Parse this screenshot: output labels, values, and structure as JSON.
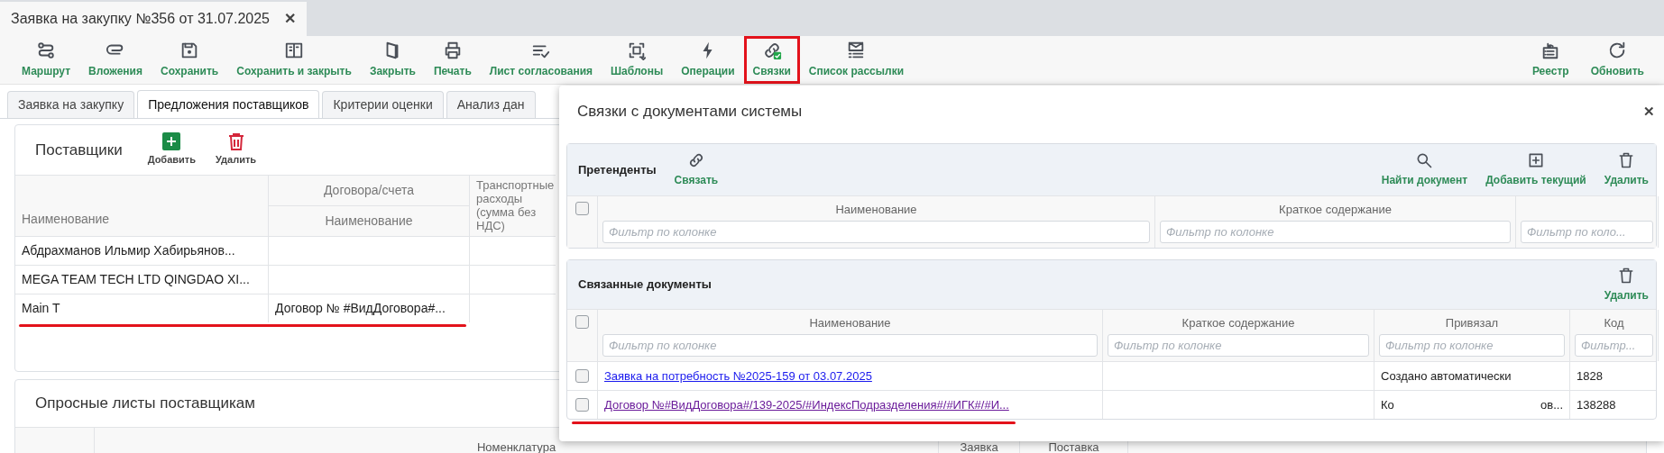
{
  "window": {
    "title": "Заявка на закупку №356 от 31.07.2025",
    "close": "✕"
  },
  "toolbar": {
    "left": [
      {
        "label": "Маршрут",
        "highlighted": false
      },
      {
        "label": "Вложения",
        "highlighted": false
      },
      {
        "label": "Сохранить",
        "highlighted": false
      },
      {
        "label": "Сохранить и закрыть",
        "highlighted": false
      },
      {
        "label": "Закрыть",
        "highlighted": false
      },
      {
        "label": "Печать",
        "highlighted": false
      },
      {
        "label": "Лист согласования",
        "highlighted": false
      },
      {
        "label": "Шаблоны",
        "highlighted": false
      },
      {
        "label": "Операции",
        "highlighted": false
      },
      {
        "label": "Связки",
        "highlighted": true
      },
      {
        "label": "Список рассылки",
        "highlighted": false
      }
    ],
    "right": [
      {
        "label": "Реестр"
      },
      {
        "label": "Обновить"
      }
    ]
  },
  "tabs": [
    {
      "label": "Заявка на закупку",
      "selected": false
    },
    {
      "label": "Предложения поставщиков",
      "selected": true
    },
    {
      "label": "Критерии оценки",
      "selected": false
    },
    {
      "label": "Анализ дан",
      "selected": false
    }
  ],
  "suppliers": {
    "title": "Поставщики",
    "actions": [
      "Добавить",
      "Удалить"
    ],
    "columns": {
      "name": "Наименование",
      "group": "Договора/счета",
      "group_sub": "Наименование",
      "transport": "Транспортные расходы (сумма без НДС)"
    },
    "rows": [
      {
        "name": "Абдрахманов Ильмир Хабирьянов...",
        "contract": "",
        "marked": false
      },
      {
        "name": "MEGA TEAM TECH LTD QINGDAO XI...",
        "contract": "",
        "marked": false
      },
      {
        "name": "Main T",
        "contract": "Договор № #ВидДоговора#...",
        "marked": true
      }
    ]
  },
  "questionnaires": {
    "title": "Опросные листы поставщикам",
    "columns": [
      "Номенклатура",
      "Заявка",
      "Поставка"
    ]
  },
  "dialog": {
    "title": "Связки с документами системы",
    "close": "✕",
    "candidates": {
      "title": "Претенденты",
      "link_action": "Связать",
      "actions": [
        "Найти документ",
        "Добавить текущий",
        "Удалить"
      ],
      "columns": [
        "Наименование",
        "Краткое содержание",
        ""
      ],
      "placeholders": [
        "Фильтр по колонке",
        "Фильтр по колонке",
        "Фильтр по коло..."
      ],
      "select_all": false
    },
    "linked": {
      "title": "Связанные документы",
      "actions": [
        "Удалить"
      ],
      "columns": [
        "Наименование",
        "Краткое содержание",
        "Привязал",
        "Код"
      ],
      "placeholders": [
        "Фильтр по колонке",
        "Фильтр по колонке",
        "Фильтр по колонке",
        "Фильтр..."
      ],
      "select_all": false,
      "rows": [
        {
          "name": "Заявка на потребность №2025-159 от 03.07.2025",
          "visited": false,
          "summary": "",
          "linked_by": [
            "Создано автоматически"
          ],
          "code": "1828",
          "checked": false,
          "marked": false
        },
        {
          "name": "Договор №#ВидДоговора#/139-2025/#ИндексПодразделения#/#ИГК#/#И...",
          "visited": true,
          "summary": "",
          "linked_by": [
            "Ко",
            "ов..."
          ],
          "code": "138288",
          "checked": false,
          "marked": true
        }
      ]
    }
  }
}
